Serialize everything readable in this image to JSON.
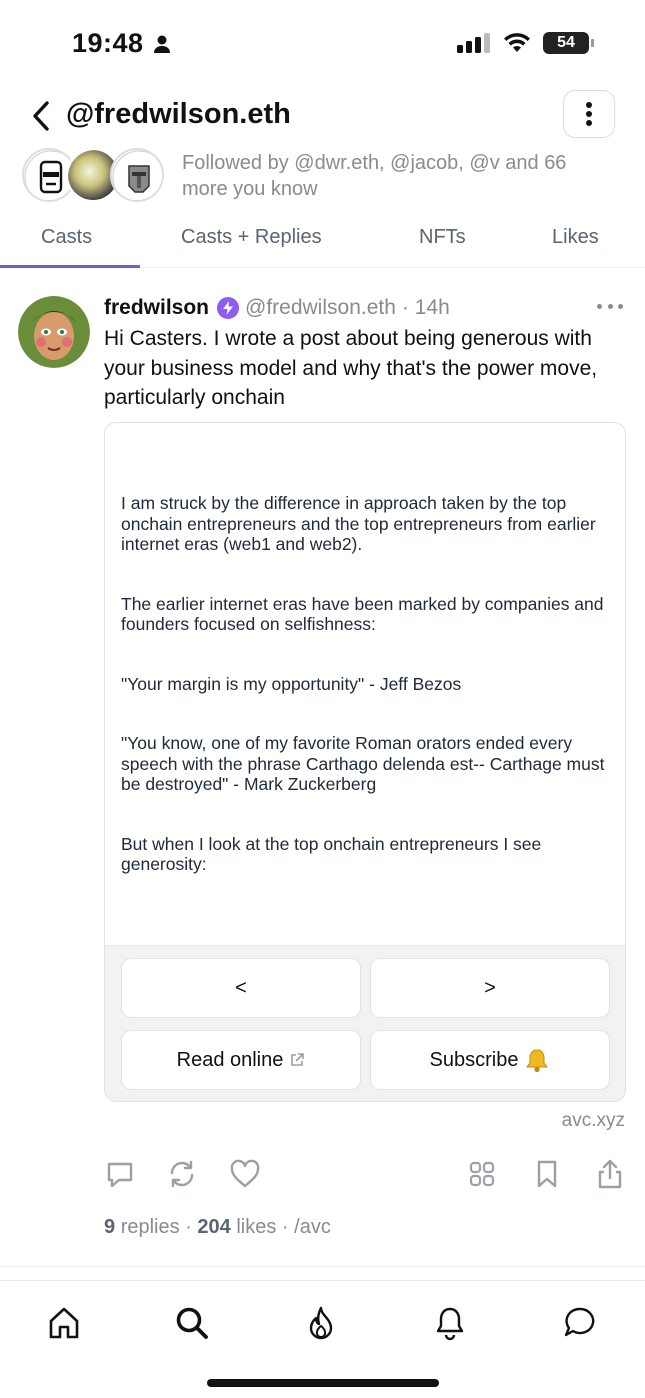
{
  "status_bar": {
    "time": "19:48",
    "battery": "54"
  },
  "header": {
    "title": "@fredwilson.eth"
  },
  "followers": {
    "text": "Followed by @dwr.eth, @jacob, @v and 66 more you know"
  },
  "tabs": [
    {
      "label": "Casts"
    },
    {
      "label": "Casts + Replies"
    },
    {
      "label": "NFTs"
    },
    {
      "label": "Likes"
    }
  ],
  "cast": {
    "name": "fredwilson",
    "handle": "@fredwilson.eth",
    "time": "· 14h",
    "text": "Hi Casters. I wrote a post about being generous with your business model and why that's the power move, particularly onchain",
    "frame": {
      "paragraphs": [
        "I am struck by the difference in approach taken by the top onchain entrepreneurs and the top entrepreneurs from earlier internet eras (web1 and web2).",
        "The earlier internet eras have been marked by companies and founders focused on selfishness:",
        "\"Your margin is my opportunity\" - Jeff Bezos",
        "\"You know, one of my favorite Roman orators ended every speech with the phrase Carthago delenda est-- Carthage must be destroyed\" - Mark Zuckerberg",
        "But when I look at the top onchain entrepreneurs I see generosity:"
      ],
      "buttons": {
        "prev": "<",
        "next": ">",
        "read_online": "Read online",
        "subscribe": "Subscribe"
      }
    },
    "domain": "avc.xyz",
    "stats": {
      "replies_count": "9",
      "replies_label": "replies",
      "likes_count": "204",
      "likes_label": "likes",
      "channel": "/avc",
      "sep": "·"
    }
  },
  "colors": {
    "accent": "#7c5cc4",
    "verified": "#8b5cf6"
  },
  "icons": {
    "nav": [
      "home-icon",
      "search-icon",
      "flame-icon",
      "bell-icon",
      "chat-icon"
    ],
    "actions": [
      "reply-icon",
      "recast-icon",
      "like-icon",
      "grid-icon",
      "bookmark-icon",
      "share-icon"
    ]
  }
}
